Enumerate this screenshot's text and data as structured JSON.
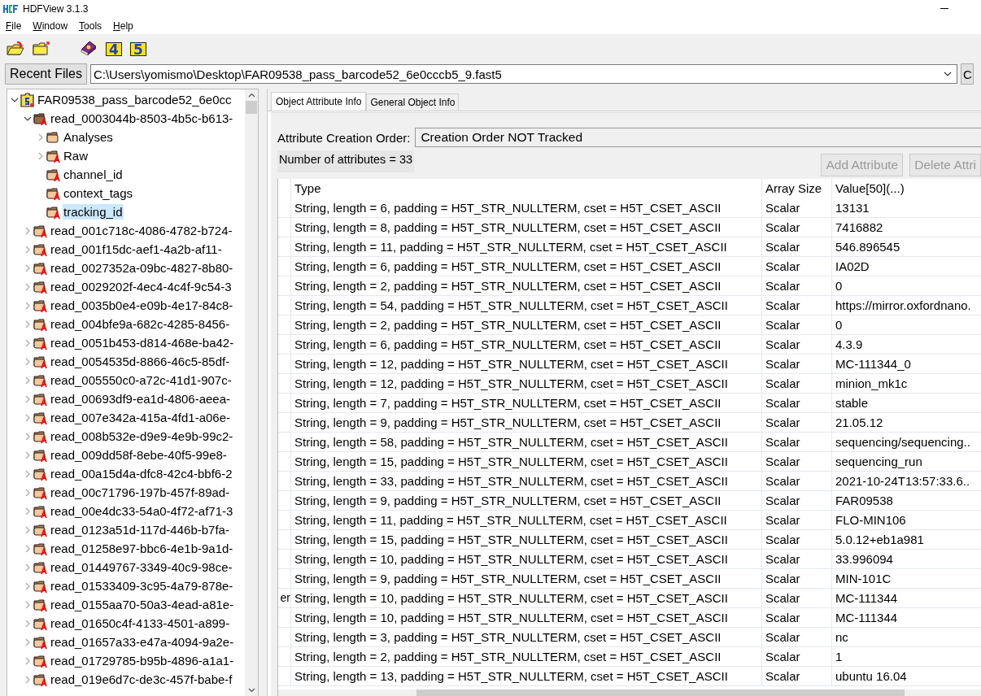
{
  "window": {
    "title": "HDFView 3.1.3"
  },
  "menu": [
    {
      "label": "File"
    },
    {
      "label": "Window"
    },
    {
      "label": "Tools"
    },
    {
      "label": "Help"
    }
  ],
  "toolbar": [
    {
      "kind": "open"
    },
    {
      "kind": "close"
    },
    {
      "kind": "help"
    },
    {
      "kind": "hdf4",
      "label": "4"
    },
    {
      "kind": "hdf5",
      "label": "5"
    }
  ],
  "recent_files_button": "Recent Files",
  "file_path": "C:\\Users\\yomismo\\Desktop\\FAR09538_pass_barcode52_6e0cccb5_9.fast5",
  "clear_button": "C",
  "tree": [
    {
      "label": "FAR09538_pass_barcode52_6e0cc",
      "kind": "file",
      "expanded": true,
      "selected": false,
      "children": [
        {
          "label": "read_0003044b-8503-4b5c-b613-",
          "kind": "group",
          "attributes": true,
          "expanded": true,
          "selected": false,
          "children": [
            {
              "label": "Analyses",
              "kind": "group",
              "attributes": false,
              "expanded": false,
              "selected": false,
              "expandable": true
            },
            {
              "label": "Raw",
              "kind": "group",
              "attributes": true,
              "expanded": false,
              "selected": false,
              "expandable": true
            },
            {
              "label": "channel_id",
              "kind": "group",
              "attributes": true,
              "expanded": false,
              "selected": false,
              "expandable": false
            },
            {
              "label": "context_tags",
              "kind": "group",
              "attributes": true,
              "expanded": false,
              "selected": false,
              "expandable": false
            },
            {
              "label": "tracking_id",
              "kind": "group",
              "attributes": true,
              "expanded": false,
              "selected": true,
              "expandable": false
            }
          ]
        },
        {
          "label": "read_001c718c-4086-4782-b724-",
          "kind": "group",
          "attributes": true,
          "expanded": false,
          "selected": false,
          "expandable": true
        },
        {
          "label": "read_001f15dc-aef1-4a2b-af11-",
          "kind": "group",
          "attributes": true,
          "expanded": false,
          "selected": false,
          "expandable": true
        },
        {
          "label": "read_0027352a-09bc-4827-8b80-",
          "kind": "group",
          "attributes": true,
          "expanded": false,
          "selected": false,
          "expandable": true
        },
        {
          "label": "read_0029202f-4ec4-4c4f-9c54-3",
          "kind": "group",
          "attributes": true,
          "expanded": false,
          "selected": false,
          "expandable": true
        },
        {
          "label": "read_0035b0e4-e09b-4e17-84c8-",
          "kind": "group",
          "attributes": true,
          "expanded": false,
          "selected": false,
          "expandable": true
        },
        {
          "label": "read_004bfe9a-682c-4285-8456-",
          "kind": "group",
          "attributes": true,
          "expanded": false,
          "selected": false,
          "expandable": true
        },
        {
          "label": "read_0051b453-d814-468e-ba42-",
          "kind": "group",
          "attributes": true,
          "expanded": false,
          "selected": false,
          "expandable": true
        },
        {
          "label": "read_0054535d-8866-46c5-85df-",
          "kind": "group",
          "attributes": true,
          "expanded": false,
          "selected": false,
          "expandable": true
        },
        {
          "label": "read_005550c0-a72c-41d1-907c-",
          "kind": "group",
          "attributes": true,
          "expanded": false,
          "selected": false,
          "expandable": true
        },
        {
          "label": "read_00693df9-ea1d-4806-aeea-",
          "kind": "group",
          "attributes": true,
          "expanded": false,
          "selected": false,
          "expandable": true
        },
        {
          "label": "read_007e342a-415a-4fd1-a06e-",
          "kind": "group",
          "attributes": true,
          "expanded": false,
          "selected": false,
          "expandable": true
        },
        {
          "label": "read_008b532e-d9e9-4e9b-99c2-",
          "kind": "group",
          "attributes": true,
          "expanded": false,
          "selected": false,
          "expandable": true
        },
        {
          "label": "read_009dd58f-8ebe-40f5-99e8-",
          "kind": "group",
          "attributes": true,
          "expanded": false,
          "selected": false,
          "expandable": true
        },
        {
          "label": "read_00a15d4a-dfc8-42c4-bbf6-2",
          "kind": "group",
          "attributes": true,
          "expanded": false,
          "selected": false,
          "expandable": true
        },
        {
          "label": "read_00c71796-197b-457f-89ad-",
          "kind": "group",
          "attributes": true,
          "expanded": false,
          "selected": false,
          "expandable": true
        },
        {
          "label": "read_00e4dc33-54a0-4f72-af71-3",
          "kind": "group",
          "attributes": true,
          "expanded": false,
          "selected": false,
          "expandable": true
        },
        {
          "label": "read_0123a51d-117d-446b-b7fa-",
          "kind": "group",
          "attributes": true,
          "expanded": false,
          "selected": false,
          "expandable": true
        },
        {
          "label": "read_01258e97-bbc6-4e1b-9a1d-",
          "kind": "group",
          "attributes": true,
          "expanded": false,
          "selected": false,
          "expandable": true
        },
        {
          "label": "read_01449767-3349-40c9-98ce-",
          "kind": "group",
          "attributes": true,
          "expanded": false,
          "selected": false,
          "expandable": true
        },
        {
          "label": "read_01533409-3c95-4a79-878e-",
          "kind": "group",
          "attributes": true,
          "expanded": false,
          "selected": false,
          "expandable": true
        },
        {
          "label": "read_0155aa70-50a3-4ead-a81e-",
          "kind": "group",
          "attributes": true,
          "expanded": false,
          "selected": false,
          "expandable": true
        },
        {
          "label": "read_01650c4f-4133-4501-a899-",
          "kind": "group",
          "attributes": true,
          "expanded": false,
          "selected": false,
          "expandable": true
        },
        {
          "label": "read_01657a33-e47a-4094-9a2e-",
          "kind": "group",
          "attributes": true,
          "expanded": false,
          "selected": false,
          "expandable": true
        },
        {
          "label": "read_01729785-b95b-4896-a1a1-",
          "kind": "group",
          "attributes": true,
          "expanded": false,
          "selected": false,
          "expandable": true
        },
        {
          "label": "read_019e6d7c-de3c-457f-babe-f",
          "kind": "group",
          "attributes": true,
          "expanded": false,
          "selected": false,
          "expandable": true
        }
      ]
    }
  ],
  "tabs": [
    {
      "label": "Object Attribute Info",
      "selected": true
    },
    {
      "label": "General Object Info",
      "selected": false
    }
  ],
  "creation_order": {
    "label": "Attribute Creation Order:",
    "value": "Creation Order NOT Tracked"
  },
  "attribute_count": "Number of attributes = 33",
  "buttons": [
    {
      "label": "Add Attribute",
      "disabled": true
    },
    {
      "label": "Delete Attri",
      "disabled": true
    }
  ],
  "table": {
    "columns": [
      "",
      "Type",
      "Array Size",
      "Value[50](...)"
    ],
    "rows": [
      {
        "type": "String, length = 6, padding = H5T_STR_NULLTERM, cset = H5T_CSET_ASCII",
        "size": "Scalar",
        "value": "13131"
      },
      {
        "type": "String, length = 8, padding = H5T_STR_NULLTERM, cset = H5T_CSET_ASCII",
        "size": "Scalar",
        "value": "7416882"
      },
      {
        "type": "String, length = 11, padding = H5T_STR_NULLTERM, cset = H5T_CSET_ASCII",
        "size": "Scalar",
        "value": "546.896545"
      },
      {
        "type": "String, length = 6, padding = H5T_STR_NULLTERM, cset = H5T_CSET_ASCII",
        "size": "Scalar",
        "value": "IA02D"
      },
      {
        "type": "String, length = 2, padding = H5T_STR_NULLTERM, cset = H5T_CSET_ASCII",
        "size": "Scalar",
        "value": "0"
      },
      {
        "type": "String, length = 54, padding = H5T_STR_NULLTERM, cset = H5T_CSET_ASCII",
        "size": "Scalar",
        "value": "https://mirror.oxfordnano."
      },
      {
        "type": "String, length = 2, padding = H5T_STR_NULLTERM, cset = H5T_CSET_ASCII",
        "size": "Scalar",
        "value": "0"
      },
      {
        "type": "String, length = 6, padding = H5T_STR_NULLTERM, cset = H5T_CSET_ASCII",
        "size": "Scalar",
        "value": "4.3.9"
      },
      {
        "type": "String, length = 12, padding = H5T_STR_NULLTERM, cset = H5T_CSET_ASCII",
        "size": "Scalar",
        "value": "MC-111344_0"
      },
      {
        "type": "String, length = 12, padding = H5T_STR_NULLTERM, cset = H5T_CSET_ASCII",
        "size": "Scalar",
        "value": "minion_mk1c"
      },
      {
        "type": "String, length = 7, padding = H5T_STR_NULLTERM, cset = H5T_CSET_ASCII",
        "size": "Scalar",
        "value": "stable"
      },
      {
        "type": "String, length = 9, padding = H5T_STR_NULLTERM, cset = H5T_CSET_ASCII",
        "size": "Scalar",
        "value": "21.05.12"
      },
      {
        "type": "String, length = 58, padding = H5T_STR_NULLTERM, cset = H5T_CSET_ASCII",
        "size": "Scalar",
        "value": "sequencing/sequencing.."
      },
      {
        "type": "String, length = 15, padding = H5T_STR_NULLTERM, cset = H5T_CSET_ASCII",
        "size": "Scalar",
        "value": "sequencing_run"
      },
      {
        "type": "String, length = 33, padding = H5T_STR_NULLTERM, cset = H5T_CSET_ASCII",
        "size": "Scalar",
        "value": "2021-10-24T13:57:33.6.."
      },
      {
        "type": "String, length = 9, padding = H5T_STR_NULLTERM, cset = H5T_CSET_ASCII",
        "size": "Scalar",
        "value": "FAR09538"
      },
      {
        "type": "String, length = 11, padding = H5T_STR_NULLTERM, cset = H5T_CSET_ASCII",
        "size": "Scalar",
        "value": "FLO-MIN106"
      },
      {
        "type": "String, length = 15, padding = H5T_STR_NULLTERM, cset = H5T_CSET_ASCII",
        "size": "Scalar",
        "value": "5.0.12+eb1a981"
      },
      {
        "type": "String, length = 10, padding = H5T_STR_NULLTERM, cset = H5T_CSET_ASCII",
        "size": "Scalar",
        "value": "33.996094"
      },
      {
        "type": "String, length = 9, padding = H5T_STR_NULLTERM, cset = H5T_CSET_ASCII",
        "size": "Scalar",
        "value": "MIN-101C"
      },
      {
        "column_1": "er",
        "type": "String, length = 10, padding = H5T_STR_NULLTERM, cset = H5T_CSET_ASCII",
        "size": "Scalar",
        "value": "MC-111344"
      },
      {
        "type": "String, length = 10, padding = H5T_STR_NULLTERM, cset = H5T_CSET_ASCII",
        "size": "Scalar",
        "value": "MC-111344"
      },
      {
        "type": "String, length = 3, padding = H5T_STR_NULLTERM, cset = H5T_CSET_ASCII",
        "size": "Scalar",
        "value": "nc"
      },
      {
        "type": "String, length = 2, padding = H5T_STR_NULLTERM, cset = H5T_CSET_ASCII",
        "size": "Scalar",
        "value": "1"
      },
      {
        "type": "String, length = 13, padding = H5T_STR_NULLTERM, cset = H5T_CSET_ASCII",
        "size": "Scalar",
        "value": "ubuntu 16.04"
      }
    ]
  }
}
